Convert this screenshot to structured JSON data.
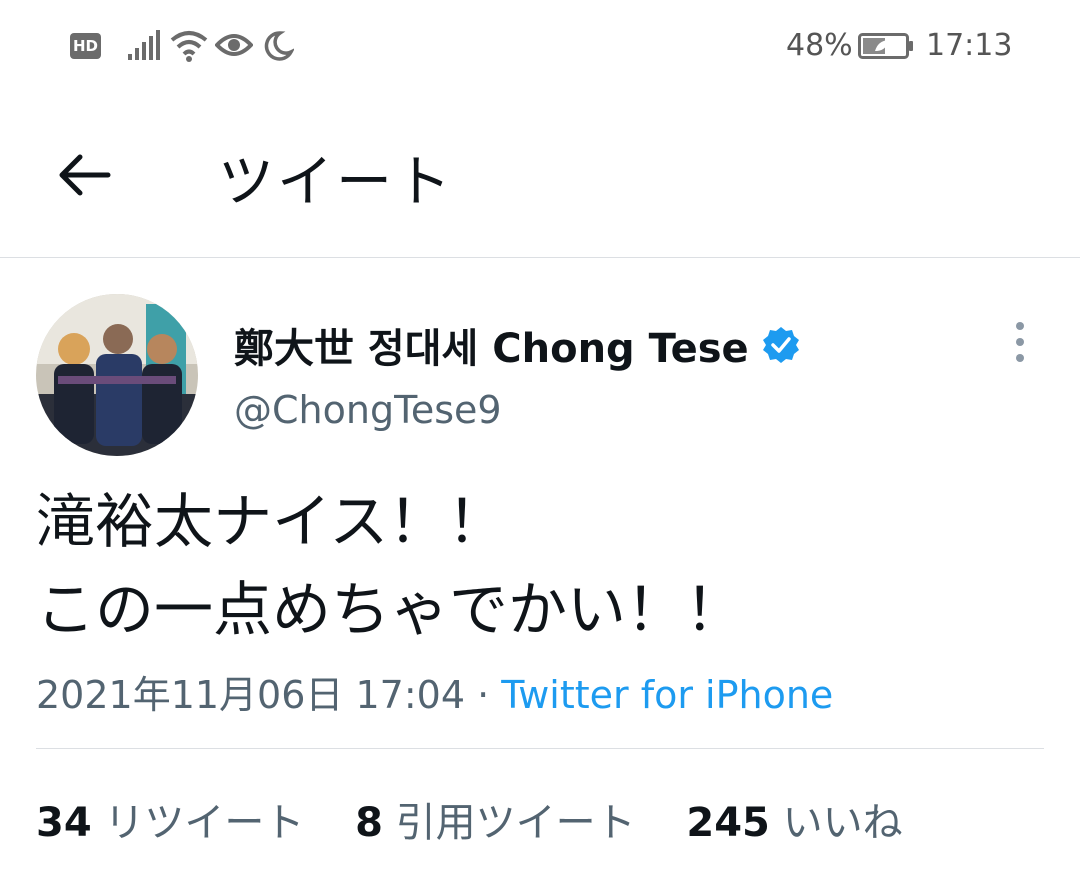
{
  "status_bar": {
    "hd_label": "HD",
    "battery_percent": "48%",
    "time": "17:13",
    "icons": [
      "hd-icon",
      "signal-icon",
      "wifi-icon",
      "eye-icon",
      "moon-icon",
      "battery-icon"
    ]
  },
  "header": {
    "title": "ツイート",
    "back_icon": "arrow-left-icon"
  },
  "tweet": {
    "display_name": "鄭大世 정대세 Chong Tese",
    "handle": "@ChongTese9",
    "verified": true,
    "text_lines": [
      "滝裕太ナイス！！",
      "この一点めちゃでかい！！"
    ],
    "datetime": "2021年11月06日 17:04",
    "separator": " · ",
    "source": "Twitter for iPhone",
    "stats": {
      "retweets_count": "34",
      "retweets_label": "リツイート",
      "quotes_count": "8",
      "quotes_label": "引用ツイート",
      "likes_count": "245",
      "likes_label": "いいね"
    }
  },
  "colors": {
    "accent": "#1d9bf0",
    "text_primary": "#0f1419",
    "text_secondary": "#536471",
    "divider": "#dcdfe3"
  }
}
